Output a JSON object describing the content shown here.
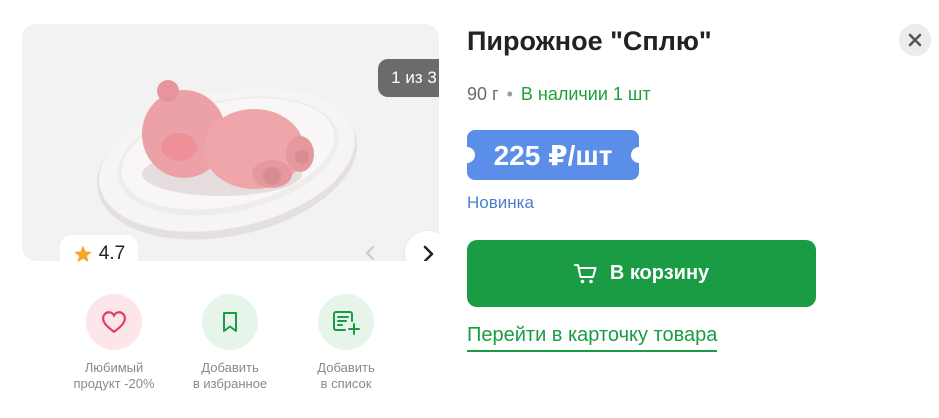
{
  "gallery": {
    "counter": "1 из 3",
    "rating": "4.7",
    "icons": {
      "prev": "chevron-left-icon",
      "next": "chevron-right-icon",
      "rating": "star-icon"
    }
  },
  "actions": {
    "favorite_label": "Любимый\nпродукт -20%",
    "bookmark_label": "Добавить\nв избранное",
    "list_label": "Добавить\nв список",
    "icons": {
      "favorite": "heart-icon",
      "bookmark": "bookmark-icon",
      "list": "add-to-list-icon"
    }
  },
  "product": {
    "title": "Пирожное \"Сплю\"",
    "weight": "90 г",
    "separator": "•",
    "stock": "В наличии 1 шт",
    "price": "225 ₽/шт",
    "badge": "Новинка"
  },
  "buttons": {
    "cart_label": "В корзину",
    "card_link": "Перейти в карточку товара",
    "close_icon": "close-icon",
    "cart_icon": "cart-icon"
  },
  "colors": {
    "green": "#1a9c45",
    "stock_green": "#21a038",
    "price_blue": "#5b8ee8",
    "new_blue": "#4a7fce",
    "heart_pink": "#e0405e"
  }
}
